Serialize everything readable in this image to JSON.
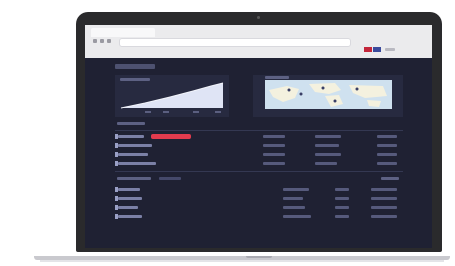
{
  "colors": {
    "screen_bg": "#1f2133",
    "panel_bg": "#272a40",
    "chart_fill": "#dfe4f5",
    "accent_red": "#e23b4e",
    "map_water": "#cfe1ef",
    "map_land": "#f4f1df"
  },
  "icons": [
    "back-arrow-icon",
    "forward-arrow-icon",
    "reload-icon",
    "flag-icon",
    "menu-icon"
  ]
}
